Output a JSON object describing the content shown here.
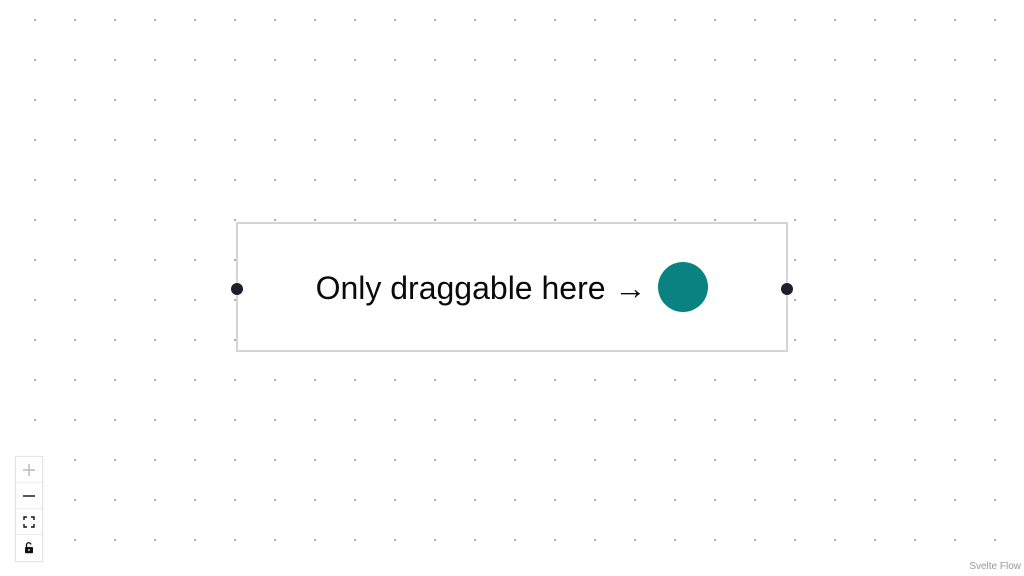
{
  "node": {
    "label": "Only draggable here →",
    "handle_color": "#0a8282"
  },
  "controls": {
    "items": [
      {
        "name": "zoom-in",
        "icon": "plus-icon",
        "disabled": true
      },
      {
        "name": "zoom-out",
        "icon": "minus-icon",
        "disabled": false
      },
      {
        "name": "fit-view",
        "icon": "fit-view-icon",
        "disabled": false
      },
      {
        "name": "toggle-interactivity",
        "icon": "unlock-icon",
        "disabled": false
      }
    ]
  },
  "attribution": {
    "text": "Svelte Flow"
  },
  "colors": {
    "background": "#ffffff",
    "dots": "#9a9aa6",
    "node_border": "#d4d4d8",
    "handle": "#1e1e2e"
  }
}
